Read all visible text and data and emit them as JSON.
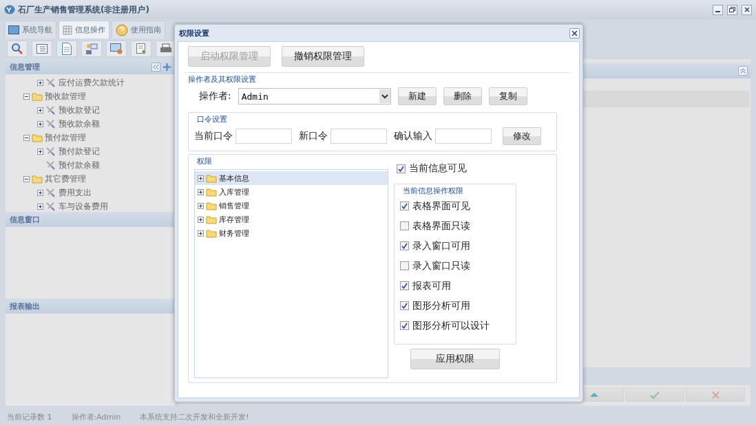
{
  "window": {
    "title": "石厂生产销售管理系统(非注册用户)"
  },
  "tabs": [
    {
      "label": "系统导航",
      "selected": false,
      "kind": "screen"
    },
    {
      "label": "信息操作",
      "selected": true,
      "kind": "grid"
    },
    {
      "label": "使用指南",
      "selected": false,
      "kind": "help"
    }
  ],
  "sidebar": {
    "panels": [
      {
        "title": "信息管理",
        "tree": [
          {
            "label": "应付运费欠款统计",
            "kind": "item",
            "expandable": true
          },
          {
            "label": "预收款管理",
            "kind": "folder",
            "expanded": true,
            "children": [
              {
                "label": "预收款登记",
                "kind": "item",
                "expandable": true
              },
              {
                "label": "预收款余额",
                "kind": "item",
                "expandable": true
              }
            ]
          },
          {
            "label": "预付款管理",
            "kind": "folder",
            "expanded": true,
            "children": [
              {
                "label": "预付款登记",
                "kind": "item",
                "expandable": true
              },
              {
                "label": "预付款余额",
                "kind": "item",
                "expandable": false
              }
            ]
          },
          {
            "label": "其它费管理",
            "kind": "folder",
            "expanded": true,
            "children": [
              {
                "label": "费用支出",
                "kind": "item",
                "expandable": true
              },
              {
                "label": "车与设备费用",
                "kind": "item",
                "expandable": true
              }
            ]
          }
        ]
      },
      {
        "title": "信息窗口"
      },
      {
        "title": "报表输出"
      }
    ]
  },
  "status_bar": [
    "当前记录数 1",
    "操作者:Admin",
    "本系统支持二次开发和全新开发!"
  ],
  "dialog": {
    "title": "权限设置",
    "top_buttons": [
      {
        "label": "启动权限管理",
        "disabled": true
      },
      {
        "label": "撤销权限管理",
        "disabled": false
      }
    ],
    "operator_group": {
      "title": "操作者及其权限设置",
      "label": "操作者:",
      "value": "Admin",
      "buttons": [
        "新建",
        "删除",
        "复制"
      ]
    },
    "password_group": {
      "title": "口令设置",
      "fields": [
        {
          "label": "当前口令"
        },
        {
          "label": "新口令"
        },
        {
          "label": "确认输入"
        }
      ],
      "button": "修改"
    },
    "rights_group": {
      "title": "权限",
      "tree": [
        {
          "label": "基本信息",
          "selected": true
        },
        {
          "label": "入库管理",
          "selected": false
        },
        {
          "label": "销售管理",
          "selected": false
        },
        {
          "label": "库存管理",
          "selected": false
        },
        {
          "label": "财务管理",
          "selected": false
        }
      ],
      "visible": {
        "label": "当前信息可见",
        "checked": true
      },
      "ops_title": "当前信息操作权限",
      "ops": [
        {
          "label": "表格界面可见",
          "checked": true
        },
        {
          "label": "表格界面只读",
          "checked": false
        },
        {
          "label": "录入窗口可用",
          "checked": true
        },
        {
          "label": "录入窗口只读",
          "checked": false
        },
        {
          "label": "报表可用",
          "checked": true
        },
        {
          "label": "图形分析可用",
          "checked": true
        },
        {
          "label": "图形分析可以设计",
          "checked": true
        }
      ],
      "apply": "应用权限"
    }
  }
}
